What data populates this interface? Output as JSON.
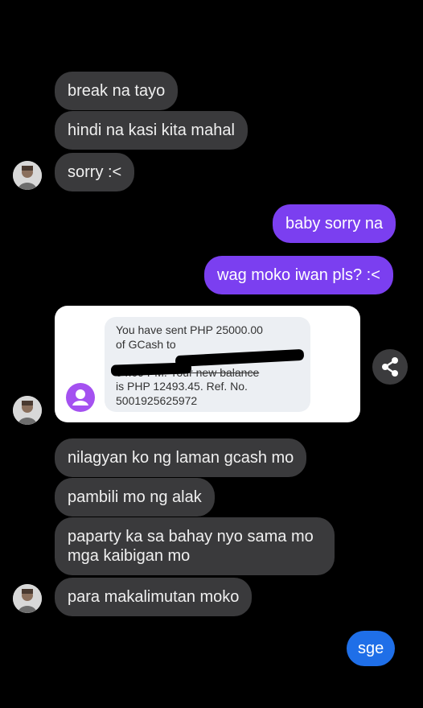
{
  "messages": {
    "m1": "break na tayo",
    "m2": "hindi na kasi kita mahal",
    "m3": "sorry :<",
    "m4": "baby sorry na",
    "m5": "wag moko iwan pls? :<",
    "m6": "nilagyan ko ng laman gcash mo",
    "m7": "pambili mo ng alak",
    "m8": "paparty ka sa bahay nyo sama mo mga kaibigan mo",
    "m9": "para makalimutan moko",
    "m10": "sge"
  },
  "sms": {
    "line1": "You have sent PHP 25000.00",
    "line2": "of GCash to",
    "line3": "on 08-13-2021",
    "line4": "04:09 PM. Your new balance",
    "line5": "is PHP 12493.45. Ref. No.",
    "line6": "5001925625972"
  },
  "colors": {
    "incoming": "#3a3a3c",
    "outgoing": "#7b3ff0",
    "blue": "#1f6fe8",
    "contact_icon": "#a451f0"
  },
  "icons": [
    "avatar",
    "contact-icon",
    "share-icon"
  ]
}
